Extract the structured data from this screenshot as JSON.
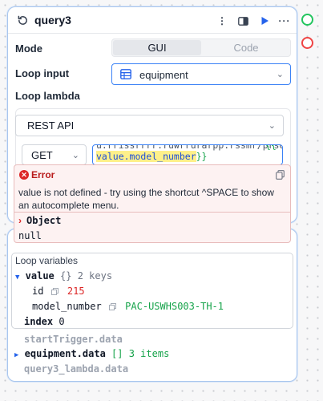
{
  "node": {
    "title": "query3",
    "mode_label": "Mode",
    "mode_options": [
      "GUI",
      "Code"
    ],
    "loop_input_label": "Loop input",
    "loop_input_value": "equipment",
    "loop_lambda_label": "Loop lambda",
    "resource_type": "REST API",
    "method": "GET",
    "url_line1_cut": "u.rrissrrrr.ruwrrurarpp.rssmr/prsdac/",
    "url_line1_brace": "{{",
    "url_line2_expr": "value.model_number",
    "url_line2_brace": "}}"
  },
  "error": {
    "title": "Error",
    "message": "value is not defined - try using the shortcut ^SPACE to show an autocomplete menu.",
    "object_label": "Object",
    "object_value": "null"
  },
  "loop_variables": {
    "title": "Loop variables",
    "value_key": "value",
    "value_type": "{}",
    "value_count": "2 keys",
    "id_key": "id",
    "id_value": "215",
    "model_number_key": "model_number",
    "model_number_value": "PAC-USWHS003-TH-1",
    "index_key": "index",
    "index_value": "0"
  },
  "context": {
    "start_trigger": "startTrigger.data",
    "equipment_key": "equipment.data",
    "equipment_type": "[]",
    "equipment_count": "3 items",
    "lambda_data": "query3_lambda.data"
  },
  "colors": {
    "accent": "#3b82f6",
    "success_handle": "#22c55e",
    "error_handle": "#ef4444",
    "error_text": "#b91c1c"
  }
}
